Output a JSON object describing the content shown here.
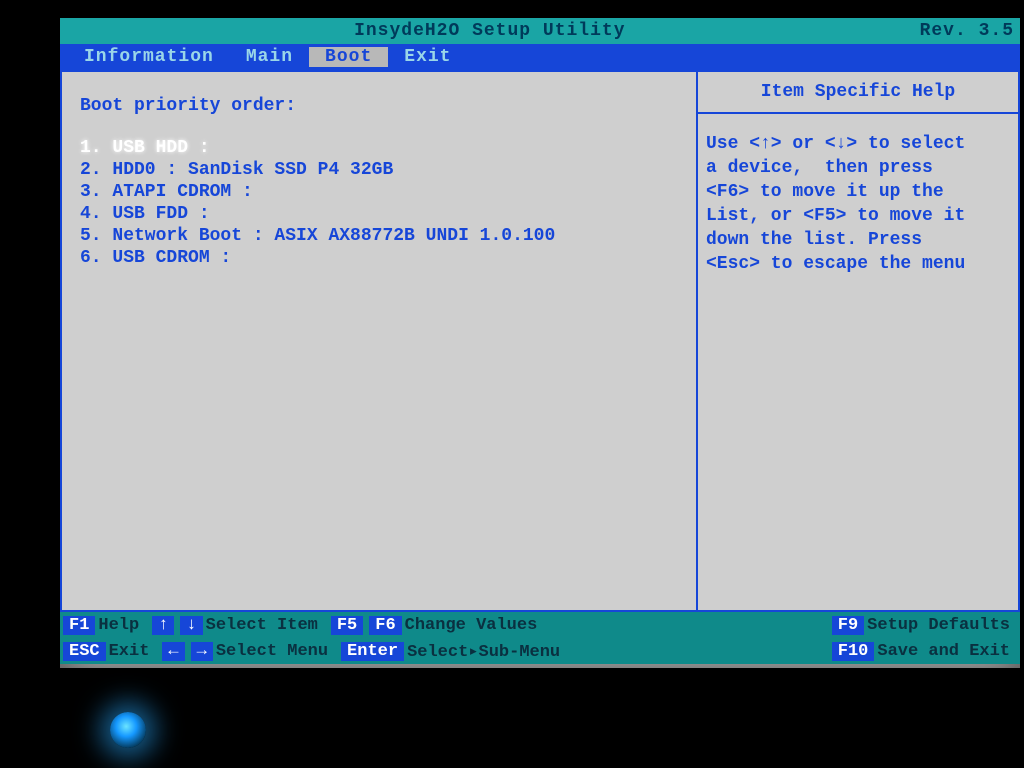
{
  "title": "InsydeH2O Setup Utility",
  "revision": "Rev. 3.5",
  "tabs": [
    "Information",
    "Main",
    "Boot",
    "Exit"
  ],
  "active_tab_index": 2,
  "left_panel": {
    "heading": "Boot priority order:"
  },
  "boot_order": [
    {
      "label": "USB HDD :",
      "selected": true
    },
    {
      "label": "HDD0 : SanDisk SSD P4 32GB",
      "selected": false
    },
    {
      "label": "ATAPI CDROM :",
      "selected": false
    },
    {
      "label": "USB FDD :",
      "selected": false
    },
    {
      "label": "Network Boot : ASIX AX88772B UNDI 1.0.100",
      "selected": false
    },
    {
      "label": "USB CDROM :",
      "selected": false
    }
  ],
  "help": {
    "title": "Item Specific Help",
    "body": "Use <↑> or <↓> to select\na device,  then press\n<F6> to move it up the\nList, or <F5> to move it\ndown the list. Press\n<Esc> to escape the menu"
  },
  "footer": {
    "row1": [
      {
        "key": "F1",
        "hint": "Help"
      },
      {
        "key": "↑",
        "hint": ""
      },
      {
        "key": "↓",
        "hint": "Select Item"
      },
      {
        "key": "F5",
        "hint": ""
      },
      {
        "key": "F6",
        "hint": "Change Values"
      }
    ],
    "row1_right": {
      "key": "F9",
      "hint": "Setup Defaults"
    },
    "row2": [
      {
        "key": "ESC",
        "hint": "Exit"
      },
      {
        "key": "←",
        "hint": ""
      },
      {
        "key": "→",
        "hint": "Select Menu"
      },
      {
        "key": "Enter",
        "hint": "Select▸Sub-Menu"
      }
    ],
    "row2_right": {
      "key": "F10",
      "hint": "Save and Exit"
    }
  }
}
